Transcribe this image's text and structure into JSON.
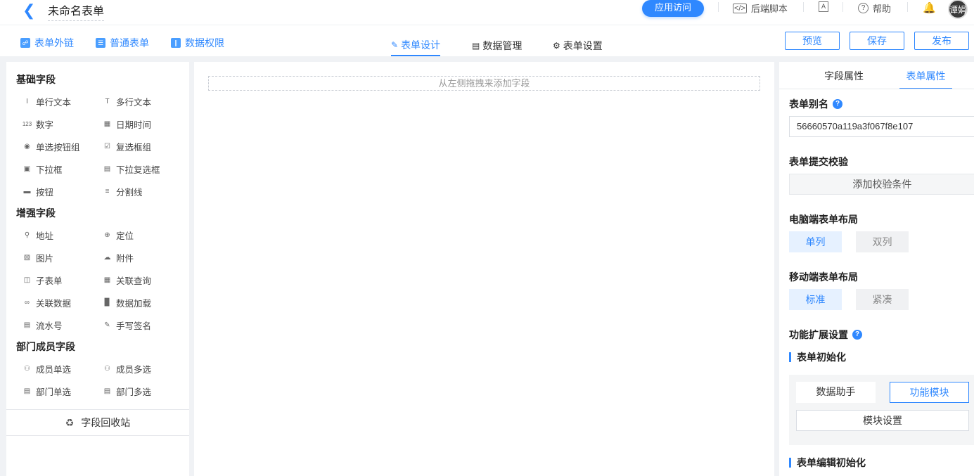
{
  "header": {
    "back_icon": "chevron-left-icon",
    "title": "未命名表单",
    "visit_button": "应用访问",
    "backend_script": "后端脚本",
    "help": "帮助",
    "avatar_text": "谭娟"
  },
  "toolbar": {
    "left_links": [
      "表单外链",
      "普通表单",
      "数据权限"
    ],
    "tabs": [
      "表单设计",
      "数据管理",
      "表单设置"
    ],
    "actions": [
      "预览",
      "保存",
      "发布"
    ]
  },
  "fields": {
    "basic_title": "基础字段",
    "basic": [
      "单行文本",
      "多行文本",
      "数字",
      "日期时间",
      "单选按钮组",
      "复选框组",
      "下拉框",
      "下拉复选框",
      "按钮",
      "分割线"
    ],
    "enhanced_title": "增强字段",
    "enhanced": [
      "地址",
      "定位",
      "图片",
      "附件",
      "子表单",
      "关联查询",
      "关联数据",
      "数据加载",
      "流水号",
      "手写签名"
    ],
    "member_title": "部门成员字段",
    "member": [
      "成员单选",
      "成员多选",
      "部门单选",
      "部门多选"
    ],
    "recycle": "字段回收站"
  },
  "canvas": {
    "drop_hint": "从左侧拖拽来添加字段"
  },
  "properties": {
    "tabs": [
      "字段属性",
      "表单属性"
    ],
    "alias_label": "表单别名",
    "alias_value": "56660570a119a3f067f8e107",
    "validation_label": "表单提交校验",
    "validation_button": "添加校验条件",
    "pc_layout_label": "电脑端表单布局",
    "pc_options": [
      "单列",
      "双列"
    ],
    "mobile_layout_label": "移动端表单布局",
    "mobile_options": [
      "标准",
      "紧凑"
    ],
    "ext_label": "功能扩展设置",
    "init_label": "表单初始化",
    "init_buttons": [
      "数据助手",
      "功能模块"
    ],
    "module_settings": "模块设置",
    "edit_init_label": "表单编辑初始化"
  },
  "colors": {
    "accent": "#2f88ff"
  }
}
